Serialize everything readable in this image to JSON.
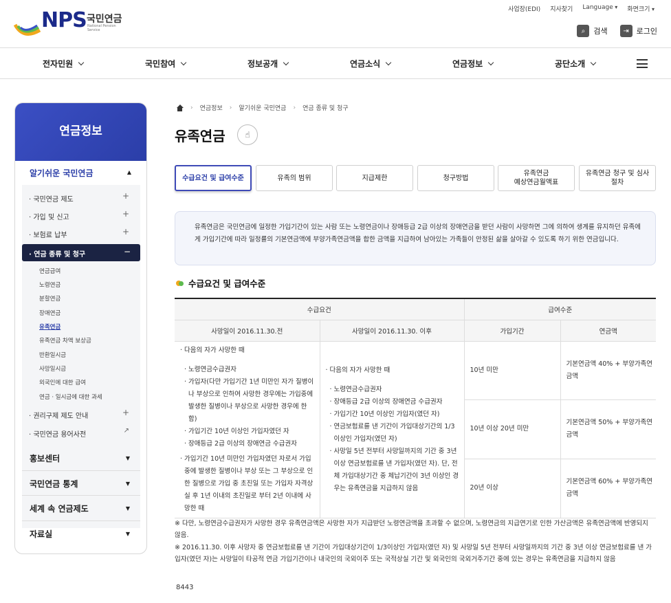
{
  "header": {
    "logo_main": "NPS",
    "logo_kr": "국민연금",
    "logo_en": "National Pension Service",
    "util": [
      "사업장(EDI)",
      "지사찾기",
      "Language",
      "화면크기"
    ],
    "search_label": "검색",
    "login_label": "로그인"
  },
  "gnb": [
    "전자민원",
    "국민참여",
    "정보공개",
    "연금소식",
    "연금정보",
    "공단소개"
  ],
  "lnb": {
    "title": "연금정보",
    "section_title": "알기쉬운 국민연금",
    "sub_items": [
      "국민연금 제도",
      "가입 및 신고",
      "보험료 납부",
      "연금 종류 및 청구",
      "권리구제 제도 안내",
      "국민연금 용어사전"
    ],
    "third_items": [
      "연금급여",
      "노령연금",
      "분할연금",
      "장애연금",
      "유족연금",
      "유족연금 차액 보상금",
      "반환일시금",
      "사망일시금",
      "외국인에 대한 급여",
      "연금 · 일시금에 대한 과세"
    ],
    "main_items": [
      "홍보센터",
      "국민연금 통계",
      "세계 속 연금제도",
      "자료실"
    ]
  },
  "breadcrumb": [
    "연금정보",
    "알기쉬운 국민연금",
    "연금 종류 및 청구"
  ],
  "page_title": "유족연금",
  "tabs": [
    "수급요건 및 급여수준",
    "유족의 범위",
    "지급제한",
    "청구방법",
    "유족연금\n예상연금월액표",
    "유족연금 청구 및 심사\n절차"
  ],
  "intro": "유족연금은 국민연금에 일정한 가입기간이 있는 사람 또는 노령연금이나 장애등급 2급 이상의 장애연금을 받던 사람이 사망하면 그에 의하여 생계를 유지하던 유족에게 가입기간에 따라 일정률의 기본연금액에 부양가족연금액을 합한 금액을 지급하여 남아있는 가족들이 안정된 삶을 살아갈 수 있도록 하기 위한 연금입니다.",
  "section_title": "수급요건 및 급여수준",
  "table": {
    "h_req": "수급요건",
    "h_level": "급여수준",
    "h_before": "사망일이 2016.11.30.전",
    "h_after": "사망일이 2016.11.30. 이후",
    "h_period": "가입기간",
    "h_amount": "연금액",
    "before": {
      "lead": "다음의 자가 사망한 때",
      "items": [
        "노령연금수급권자",
        "가입자(다만 가입기간 1년 미만인 자가 질병이나 부상으로 인하여 사망한 경우에는 가입중에 발생한 질병이나 부상으로 사망한 경우에 한함)",
        "가입기간 10년 이상인 가입자였던 자",
        "장애등급 2급 이상의 장애연금 수급권자"
      ],
      "extra": "가입기간 10년 미만인 가입자였던 자로서 가입 중에 발생한 질병이나 부상 또는 그 부상으로 인한 질병으로 가입 중 초진일 또는 가입자 자격상실 후 1년 이내의 초진일로 부터 2년 이내에 사망한 때"
    },
    "after": {
      "lead": "다음의 자가 사망한 때",
      "items": [
        "노령연금수급권자",
        "장애등급 2급 이상의 장애연금 수급권자",
        "가입기간 10년 이상인 가입자(였던 자)",
        "연금보험료를 낸 기간이 가입대상기간의 1/3이상인 가입자(였던 자)",
        "사망일 5년 전부터 사망일까지의 기간 중 3년 이상 연금보험료를 낸 가입자(였던 자). 단, 전체 가입대상기간 중 체납기간이 3년 이상인 경우는 유족연금을 지급하지 않음"
      ]
    },
    "rows": [
      {
        "period": "10년 미만",
        "amount": "기본연금액 40% + 부양가족연금액"
      },
      {
        "period": "10년 이상 20년 미만",
        "amount": "기본연금액 50% + 부양가족연금액"
      },
      {
        "period": "20년 이상",
        "amount": "기본연금액 60% + 부양가족연금액"
      }
    ]
  },
  "notes": [
    "※ 다만, 노령연금수급권자가 사망한 경우 유족연금액은 사망한 자가 지급받던 노령연금액을 초과할 수 없으며, 노령연금의 지급연기로 인한 가산금액은 유족연금액에 반영되지 않음.",
    "※ 2016.11.30. 이후 사망자 중 연금보험료를 낸 기간이 가입대상기간이 1/3이상인 가입자(였던 자) 및 사망일 5년 전부터 사망일까지의 기간 중 3년 이상 연금보험료를 낸 가입자(였던 자)는 사망일이 타공적 연금 가입기간이나 내국인의 국외이주 또는 국적상실 기간 및 외국인의 국외거주기간 중에 있는 경우는 유족연금을 지급하지 않음"
  ],
  "page_number": "8443"
}
